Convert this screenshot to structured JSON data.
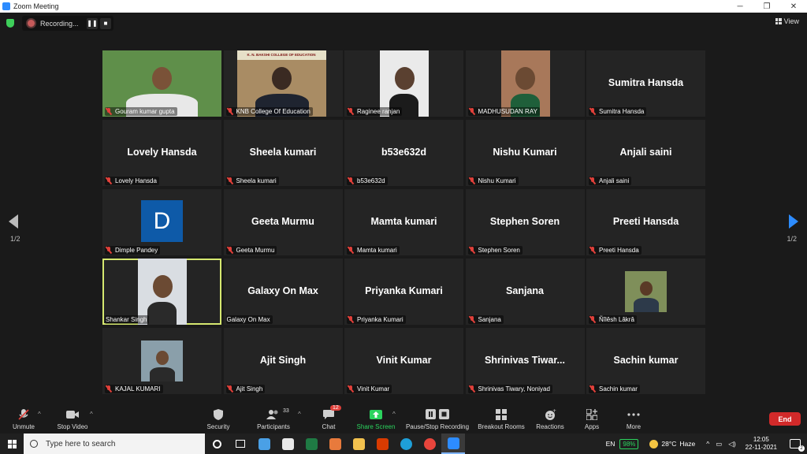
{
  "window": {
    "title": "Zoom Meeting",
    "controls": [
      "─",
      "❐",
      "✕"
    ]
  },
  "topbar": {
    "recording_label": "Recording...",
    "pause_glyph": "❚❚",
    "stop_glyph": "■",
    "view_label": "View"
  },
  "pagination": {
    "left": "1/2",
    "right": "1/2"
  },
  "participants": [
    {
      "name": "Gouram kumar gupta",
      "video": true,
      "muted": true
    },
    {
      "name": "KNB College Of Education",
      "video": true,
      "muted": true,
      "banner": "K. N. BAKSHI COLLEGE OF EDUCATION"
    },
    {
      "name": "Raginee ranjan",
      "video": true,
      "muted": true
    },
    {
      "name": "MADHUSUDAN RAY",
      "video": true,
      "muted": true
    },
    {
      "name": "Sumitra Hansda",
      "video": false,
      "muted": true
    },
    {
      "name": "Lovely Hansda",
      "video": false,
      "muted": true
    },
    {
      "name": "Sheela kumari",
      "video": false,
      "muted": true
    },
    {
      "name": "b53e632d",
      "video": false,
      "muted": true
    },
    {
      "name": "Nishu Kumari",
      "video": false,
      "muted": true
    },
    {
      "name": "Anjali saini",
      "video": false,
      "muted": true
    },
    {
      "name": "Dimple Pandey",
      "video": false,
      "avatar_letter": "D",
      "muted": true
    },
    {
      "name": "Geeta Murmu",
      "video": false,
      "muted": true
    },
    {
      "name": "Mamta kumari",
      "video": false,
      "muted": true
    },
    {
      "name": "Stephen Soren",
      "video": false,
      "muted": true
    },
    {
      "name": "Preeti Hansda",
      "video": false,
      "muted": true
    },
    {
      "name": "Shankar Singh",
      "video": true,
      "muted": false,
      "active_speaker": true
    },
    {
      "name": "Galaxy On Max",
      "video": false,
      "muted": false
    },
    {
      "name": "Priyanka Kumari",
      "video": false,
      "muted": true
    },
    {
      "name": "Sanjana",
      "video": false,
      "muted": true
    },
    {
      "name": "Ñîlêsh Lâkrâ",
      "video": true,
      "muted": true
    },
    {
      "name": "KAJAL KUMARI",
      "video": true,
      "muted": true
    },
    {
      "name": "Ajit Singh",
      "video": false,
      "muted": true
    },
    {
      "name": "Vinit Kumar",
      "video": false,
      "muted": true
    },
    {
      "name": "Shrinivas Tiwary, Noniyad",
      "display_name": "Shrinivas  Tiwar...",
      "video": false,
      "muted": true
    },
    {
      "name": "Sachin kumar",
      "video": false,
      "muted": true
    }
  ],
  "toolbar": {
    "unmute": "Unmute",
    "stop_video": "Stop Video",
    "security": "Security",
    "participants": "Participants",
    "participants_count": "33",
    "chat": "Chat",
    "chat_badge": "12",
    "share_screen": "Share Screen",
    "pause_recording": "Pause/Stop Recording",
    "breakout": "Breakout Rooms",
    "reactions": "Reactions",
    "apps": "Apps",
    "more": "More",
    "end": "End"
  },
  "taskbar": {
    "search_placeholder": "Type here to search",
    "language": "EN",
    "battery": "98%",
    "temperature": "28°C",
    "weather": "Haze",
    "time": "12:05",
    "date": "22-11-2021",
    "notifications": "2"
  },
  "colors": {
    "accent": "#2d8cff",
    "active_speaker": "#d6e870",
    "end": "#d22a2a",
    "muted": "#e0403a"
  }
}
